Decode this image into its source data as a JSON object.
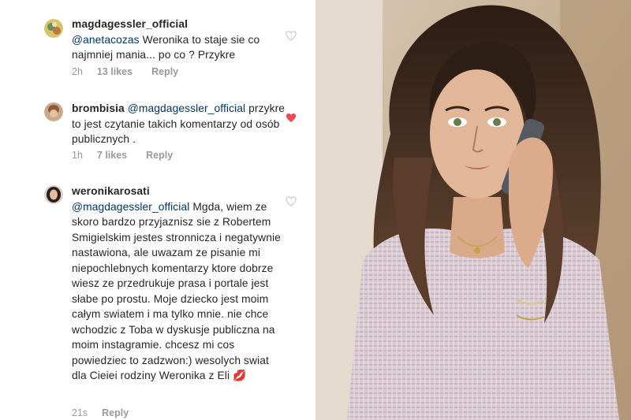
{
  "comments": [
    {
      "username": "magdagessler_official",
      "mention": "@anetacozas",
      "text": " Weronika to staje sie co najmniej mania... po co ? Przykre",
      "time": "2h",
      "likes": "13 likes",
      "reply": "Reply",
      "liked": false
    },
    {
      "username": "brombisia",
      "mention": "@magdagessler_official",
      "text": " przykre to jest czytanie takich komentarzy od osób publicznych .",
      "time": "1h",
      "likes": "7 likes",
      "reply": "Reply",
      "liked": true
    },
    {
      "username": "weronikarosati",
      "mention": "@magdagessler_official",
      "text": " Mgda, wiem ze skoro bardzo przyjaznisz sie z Robertem Smigielskim jestes stronnicza i negatywnie nastawiona, ale uwazam ze pisanie mi niepochlebnych komentarzy ktore dobrze wiesz ze przedrukuje prasa i portale jest słabe po prostu. Moje dziecko jest moim całym swiatem i ma tylko mnie. nie chce wchodzic z Toba w  dyskusje publiczna na moim instagramie. chcesz mi cos powiedziec to zadzwon:) wesolych swiat dla Cieiei rodziny Weronika z Eli 💋",
      "time": "21s",
      "reply": "Reply",
      "liked": false
    }
  ],
  "icons": {
    "heart_outline": "heart-outline-icon",
    "heart_filled": "heart-filled-icon"
  },
  "colors": {
    "text": "#262626",
    "mention": "#003569",
    "meta": "#999999",
    "liked_heart": "#ed4956",
    "outline_heart": "#c7c7c7"
  }
}
